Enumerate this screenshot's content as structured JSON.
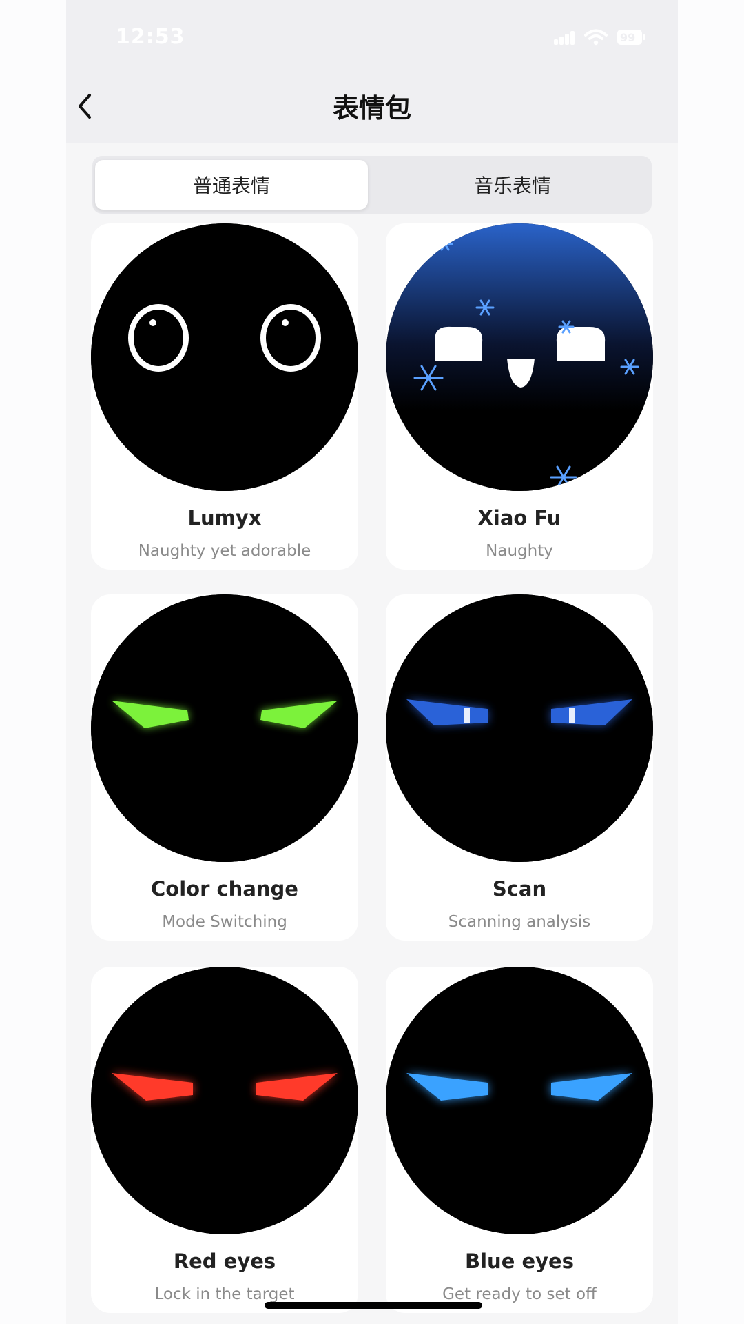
{
  "status_bar": {
    "time": "12:53",
    "battery": "99"
  },
  "header": {
    "title": "表情包"
  },
  "tabs": [
    {
      "label": "普通表情",
      "active": true
    },
    {
      "label": "音乐表情",
      "active": false
    }
  ],
  "cards": [
    {
      "title": "Lumyx",
      "subtitle": "Naughty yet adorable"
    },
    {
      "title": "Xiao Fu",
      "subtitle": "Naughty"
    },
    {
      "title": "Color change",
      "subtitle": "Mode Switching"
    },
    {
      "title": "Scan",
      "subtitle": "Scanning analysis"
    },
    {
      "title": "Red eyes",
      "subtitle": "Lock in the target"
    },
    {
      "title": "Blue eyes",
      "subtitle": "Get ready to set off"
    }
  ],
  "colors": {
    "accent_green": "#7cf23b",
    "accent_blue": "#2a62d8",
    "accent_red": "#ff3a2a",
    "accent_light_blue": "#3aa2ff",
    "snow_blue": "#3f7fe0"
  }
}
